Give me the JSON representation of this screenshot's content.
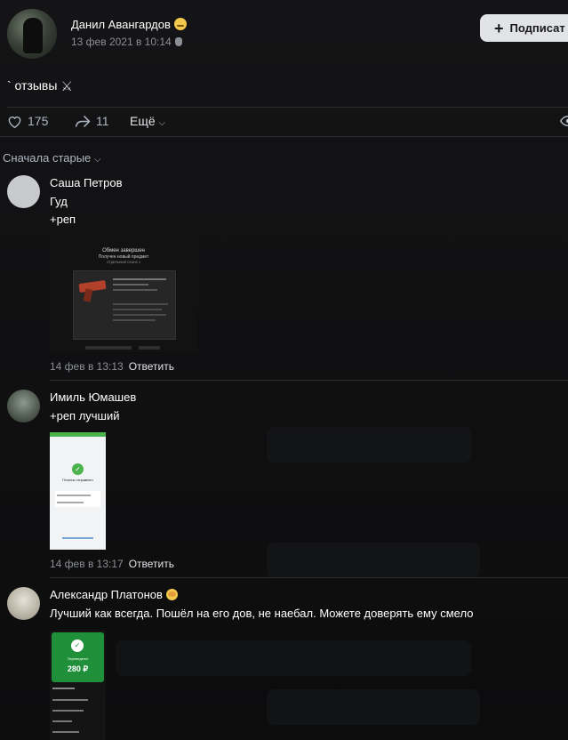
{
  "post": {
    "author": "Данил Авангардов",
    "date": "13 фев 2021 в 10:14",
    "subscribe_label": "Подписат",
    "text": "` отзывы",
    "likes": "175",
    "shares": "11",
    "more_label": "Ещё"
  },
  "sort_label": "Сначала старые",
  "comments": [
    {
      "author": "Саша Петров",
      "lines": [
        "Гуд",
        "+реп"
      ],
      "date": "14 фев в 13:13",
      "reply": "Ответить",
      "screenshot": {
        "title": "Обмен завершен",
        "subtitle": "Получен новый предмет",
        "caption": "ОТДЕЛЬНЫЙ СЕАНС 2"
      }
    },
    {
      "author": "Имиль Юмашев",
      "lines": [
        "+реп лучший"
      ],
      "date": "14 фев в 13:17",
      "reply": "Ответить",
      "screenshot": {
        "title": "Платеж отправлен"
      }
    },
    {
      "author": "Александр Платонов",
      "lines": [
        "Лучший как всегда. Пошёл на его дов, не наебал. Можете доверять ему смело"
      ],
      "screenshot": {
        "title": "Переведено!",
        "amount": "280 ₽"
      }
    }
  ],
  "colors": {
    "background": "#0f0f10",
    "text": "#e1e3e6",
    "secondary": "#8b8f96",
    "divider": "#2c2d2e",
    "success": "#4bb34b"
  }
}
